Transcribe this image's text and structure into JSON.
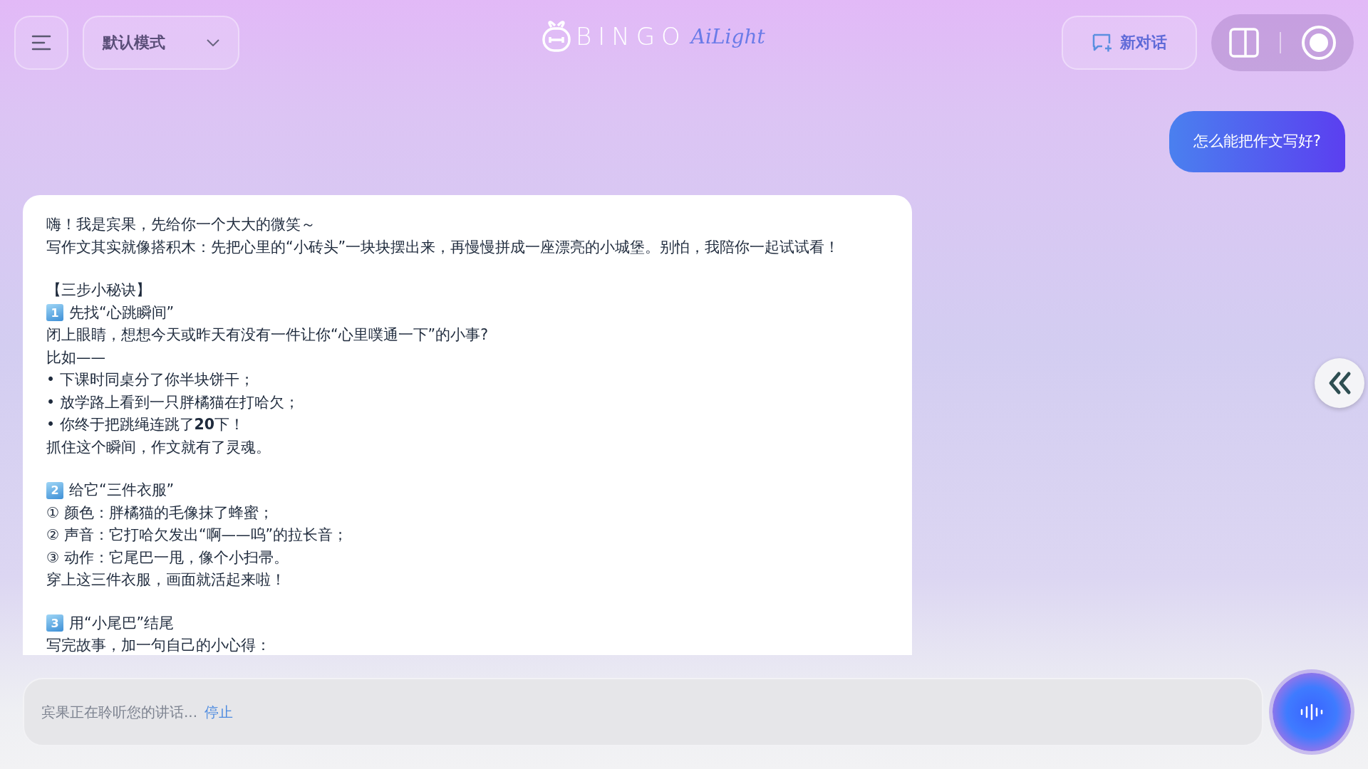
{
  "header": {
    "mode_select": {
      "value": "默认模式"
    },
    "logo": {
      "brand": "BINGO",
      "sub": "AiLight"
    },
    "new_chat_button": {
      "label": "新对话"
    }
  },
  "messages": [
    {
      "kind": "user",
      "text": "怎么能把作文写好?"
    },
    {
      "kind": "assistant",
      "lines": [
        {
          "kind": "text",
          "text": "嗨！我是宾果，先给你一个大大的微笑～"
        },
        {
          "kind": "text",
          "text": "写作文其实就像搭积木：先把心里的“小砖头”一块块摆出来，再慢慢拼成一座漂亮的小城堡。别怕，我陪你一起试试看！"
        },
        {
          "kind": "gap"
        },
        {
          "kind": "text",
          "text": "【三步小秘诀】"
        },
        {
          "kind": "heading",
          "badge": "1",
          "text": "先找“心跳瞬间”"
        },
        {
          "kind": "text",
          "text": "闭上眼睛，想想今天或昨天有没有一件让你“心里噗通一下”的小事?"
        },
        {
          "kind": "text",
          "text": "比如——"
        },
        {
          "kind": "text",
          "text": "• 下课时同桌分了你半块饼干；"
        },
        {
          "kind": "text",
          "text": "• 放学路上看到一只胖橘猫在打哈欠；"
        },
        {
          "kind": "text",
          "text": "• 你终于把跳绳连跳了**20**下！"
        },
        {
          "kind": "text",
          "text": "抓住这个瞬间，作文就有了灵魂。"
        },
        {
          "kind": "gap"
        },
        {
          "kind": "heading",
          "badge": "2",
          "text": "给它“三件衣服”"
        },
        {
          "kind": "text",
          "text": "① 颜色：胖橘猫的毛像抹了蜂蜜；"
        },
        {
          "kind": "text",
          "text": "② 声音：它打哈欠发出“啊——呜”的拉长音；"
        },
        {
          "kind": "text",
          "text": "③ 动作：它尾巴一甩，像个小扫帚。"
        },
        {
          "kind": "text",
          "text": "穿上这三件衣服，画面就活起来啦！"
        },
        {
          "kind": "gap"
        },
        {
          "kind": "heading",
          "badge": "3",
          "text": "用“小尾巴”结尾"
        },
        {
          "kind": "text",
          "text": "写完故事，加一句自己的小心得："
        }
      ]
    }
  ],
  "input": {
    "status": "宾果正在聆听您的讲话...",
    "stop_link": "停止"
  }
}
